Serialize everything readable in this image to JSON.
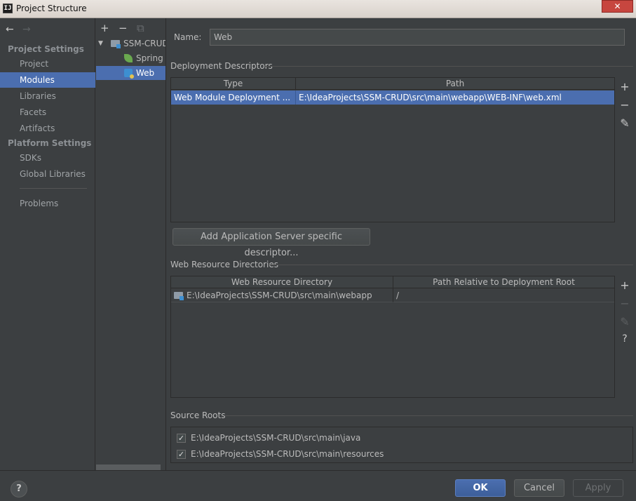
{
  "window": {
    "title": "Project Structure",
    "app_icon": "IJ"
  },
  "nav": {
    "back_icon": "←",
    "forward_icon": "→",
    "project_settings_header": "Project Settings",
    "project_items": [
      "Project",
      "Modules",
      "Libraries",
      "Facets",
      "Artifacts"
    ],
    "platform_settings_header": "Platform Settings",
    "platform_items": [
      "SDKs",
      "Global Libraries"
    ],
    "problems": "Problems",
    "selected": "Modules"
  },
  "tree": {
    "toolbar": {
      "add": "+",
      "remove": "−",
      "copy": "⧉"
    },
    "module": "SSM-CRUD",
    "facets": [
      "Spring",
      "Web"
    ],
    "selected": "Web"
  },
  "name_field": {
    "label": "Name:",
    "value": "Web"
  },
  "deployment_descriptors": {
    "title": "Deployment Descriptors",
    "columns": [
      "Type",
      "Path"
    ],
    "rows": [
      [
        "Web Module Deployment ...",
        "E:\\IdeaProjects\\SSM-CRUD\\src\\main\\webapp\\WEB-INF\\web.xml"
      ]
    ],
    "tools": {
      "add": "+",
      "remove": "−",
      "edit": "✎"
    },
    "add_server_button": "Add Application Server specific descriptor..."
  },
  "web_resource_directories": {
    "title": "Web Resource Directories",
    "columns": [
      "Web Resource Directory",
      "Path Relative to Deployment Root"
    ],
    "rows": [
      [
        "E:\\IdeaProjects\\SSM-CRUD\\src\\main\\webapp",
        "/"
      ]
    ],
    "tools": {
      "add": "+",
      "remove": "−",
      "edit": "✎",
      "help": "?"
    }
  },
  "source_roots": {
    "title": "Source Roots",
    "items": [
      {
        "path": "E:\\IdeaProjects\\SSM-CRUD\\src\\main\\java",
        "checked": true
      },
      {
        "path": "E:\\IdeaProjects\\SSM-CRUD\\src\\main\\resources",
        "checked": true
      }
    ]
  },
  "footer": {
    "help": "?",
    "ok": "OK",
    "cancel": "Cancel",
    "apply": "Apply"
  },
  "close_icon": "✕",
  "checkmark": "✓",
  "colors": {
    "selection": "#4b6eaf",
    "background": "#3c3f41",
    "close": "#c7463f"
  }
}
